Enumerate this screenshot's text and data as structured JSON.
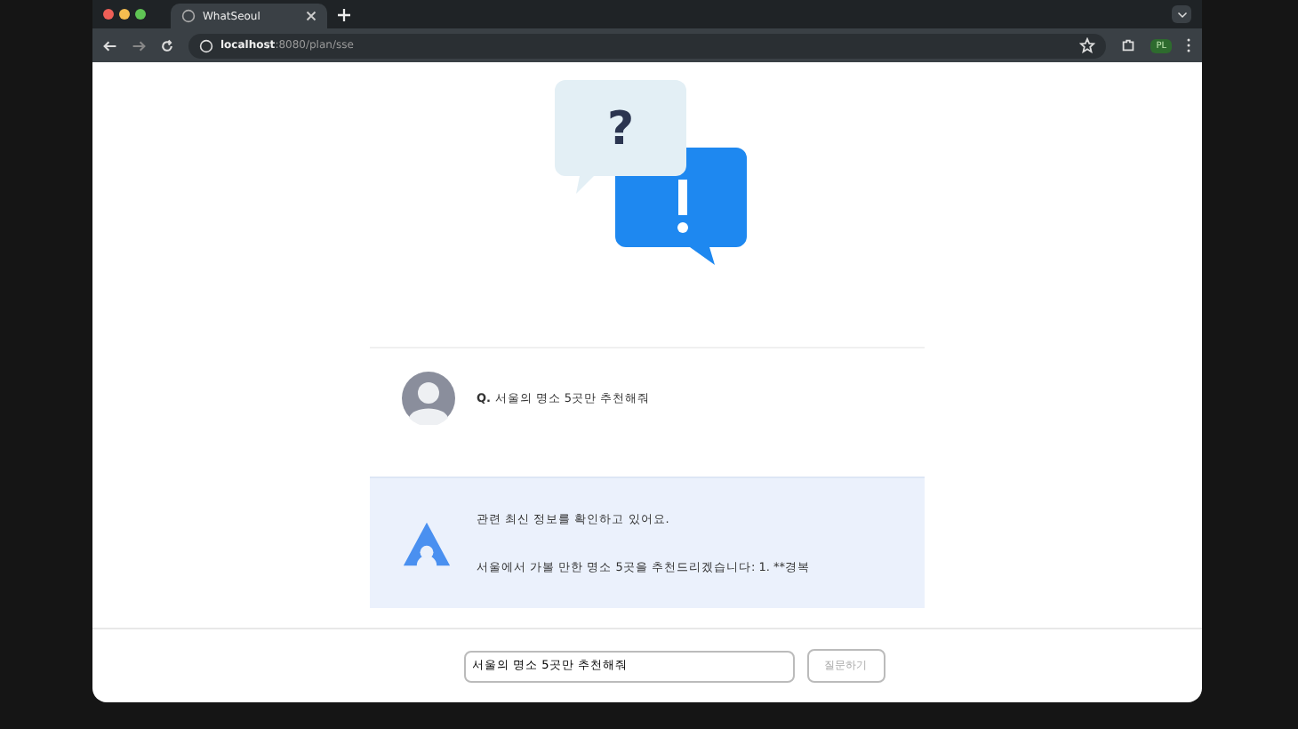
{
  "browser": {
    "tab_title": "WhatSeoul",
    "url_host": "localhost",
    "url_path": ":8080/plan/sse",
    "profile_badge": "PL"
  },
  "hero": {
    "mark": "?"
  },
  "question": {
    "prefix": "Q.",
    "text": "서울의 명소 5곳만 추천해줘"
  },
  "answer": {
    "status": "관련 최신 정보를 확인하고 있어요.",
    "text": "서울에서 가볼 만한 명소 5곳을 추천드리겠습니다: 1. **경복"
  },
  "composer": {
    "value": "서울의 명소 5곳만 추천해줘",
    "button": {
      "label": "질문하기",
      "disabled": true
    }
  }
}
